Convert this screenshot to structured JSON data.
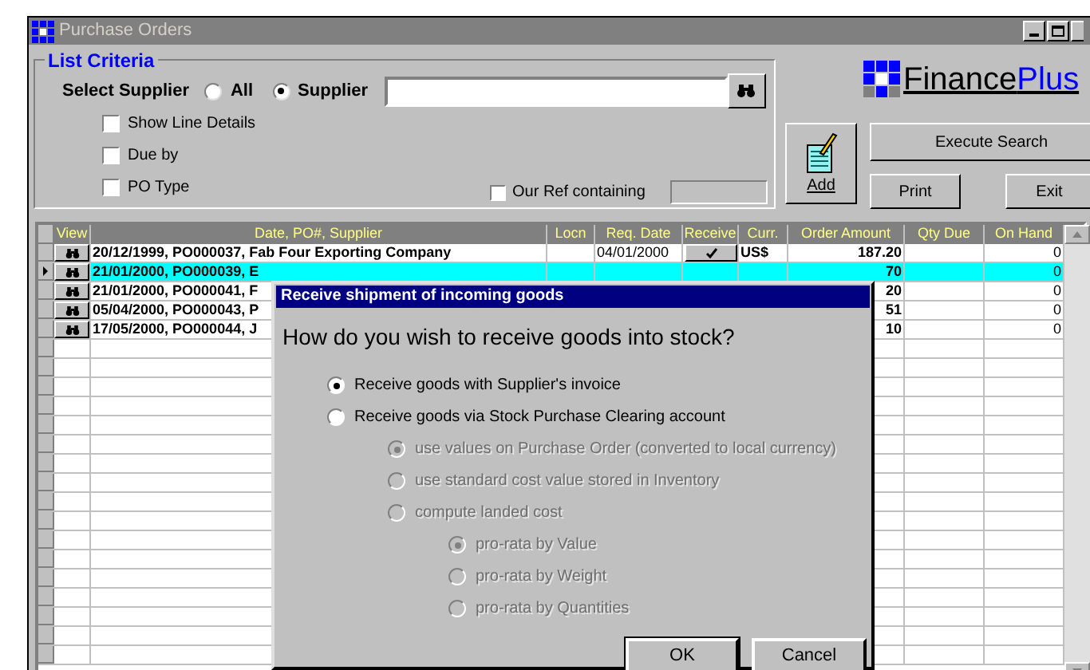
{
  "window": {
    "title": "Purchase Orders"
  },
  "criteria": {
    "title": "List Criteria",
    "supplier_label": "Select Supplier",
    "radios": [
      {
        "label": "All",
        "selected": false
      },
      {
        "label": "Supplier",
        "selected": true
      }
    ],
    "checks": [
      {
        "label": "Show Line Details",
        "checked": false
      },
      {
        "label": "Due by",
        "checked": false
      },
      {
        "label": "PO Type",
        "checked": false
      }
    ],
    "ref": {
      "label": "Our Ref containing",
      "checked": false
    }
  },
  "logo": {
    "part1": "Finance",
    "part2": "Plus"
  },
  "buttons": {
    "add": "Add",
    "execute": "Execute Search",
    "print": "Print",
    "exit": "Exit"
  },
  "table": {
    "columns": [
      "View",
      "Date, PO#, Supplier",
      "Locn",
      "Req. Date",
      "Receive",
      "Curr.",
      "Order Amount",
      "Qty Due",
      "On Hand"
    ],
    "rows": [
      {
        "selected": false,
        "date_po_supplier": "20/12/1999,  PO000037, Fab Four Exporting Company",
        "req_date": "04/01/2000",
        "received": true,
        "currency": "US$",
        "order_amount": "187.20",
        "on_hand": "0"
      },
      {
        "selected": true,
        "date_po_supplier": "21/01/2000,  PO000039, E",
        "order_amount": "70",
        "on_hand": "0"
      },
      {
        "selected": false,
        "date_po_supplier": "21/01/2000,  PO000041, F",
        "order_amount": "20",
        "on_hand": "0"
      },
      {
        "selected": false,
        "date_po_supplier": "05/04/2000,  PO000043, P",
        "order_amount": "51",
        "on_hand": "0"
      },
      {
        "selected": false,
        "date_po_supplier": "17/05/2000,  PO000044, J",
        "order_amount": "10",
        "on_hand": "0"
      }
    ]
  },
  "dialog": {
    "title": "Receive shipment of incoming goods",
    "question": "How do you wish to receive goods into stock?",
    "options": [
      {
        "label": "Receive goods with Supplier's invoice",
        "selected": true,
        "disabled": false
      },
      {
        "label": "Receive goods via Stock Purchase Clearing account",
        "selected": false,
        "disabled": false,
        "children": [
          {
            "label": "use values on Purchase Order (converted to local currency)",
            "selected": true,
            "disabled": true
          },
          {
            "label": "use standard cost value stored in Inventory",
            "selected": false,
            "disabled": true
          },
          {
            "label": "compute landed cost",
            "selected": false,
            "disabled": true,
            "children": [
              {
                "label": "pro-rata by Value",
                "selected": true,
                "disabled": true
              },
              {
                "label": "pro-rata by Weight",
                "selected": false,
                "disabled": true
              },
              {
                "label": "pro-rata by Quantities",
                "selected": false,
                "disabled": true
              }
            ]
          }
        ]
      }
    ],
    "ok": "OK",
    "cancel": "Cancel"
  }
}
